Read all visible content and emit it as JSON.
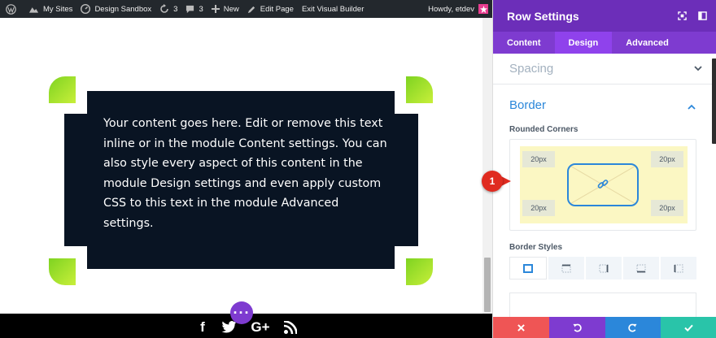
{
  "adminbar": {
    "my_sites": "My Sites",
    "site_name": "Design Sandbox",
    "updates_count": "3",
    "comments_count": "3",
    "new_label": "New",
    "edit_page": "Edit Page",
    "exit_builder": "Exit Visual Builder",
    "howdy": "Howdy, etdev"
  },
  "module": {
    "text": "Your content goes here. Edit or remove this text inline or in the module Content settings. You can also style every aspect of this content in the module Design settings and even apply custom CSS to this text in the module Advanced settings."
  },
  "footer": {
    "social": [
      "f",
      "twitter",
      "G+",
      "rss"
    ],
    "gplus": "G+",
    "facebook": "f"
  },
  "panel": {
    "title": "Row Settings",
    "tabs": [
      "Content",
      "Design",
      "Advanced"
    ],
    "spacing_label": "Spacing",
    "border_label": "Border",
    "rounded_corners_label": "Rounded Corners",
    "corners": {
      "top_left": "20px",
      "top_right": "20px",
      "bottom_left": "20px",
      "bottom_right": "20px"
    },
    "border_styles_label": "Border Styles",
    "marker_number": "1"
  },
  "colors": {
    "accent": "#2b87da",
    "purple": "#7e3bd0",
    "footer_cancel": "#ef5555",
    "footer_undo": "#7e3bd0",
    "footer_redo": "#2b87da",
    "footer_save": "#29c4a9"
  }
}
